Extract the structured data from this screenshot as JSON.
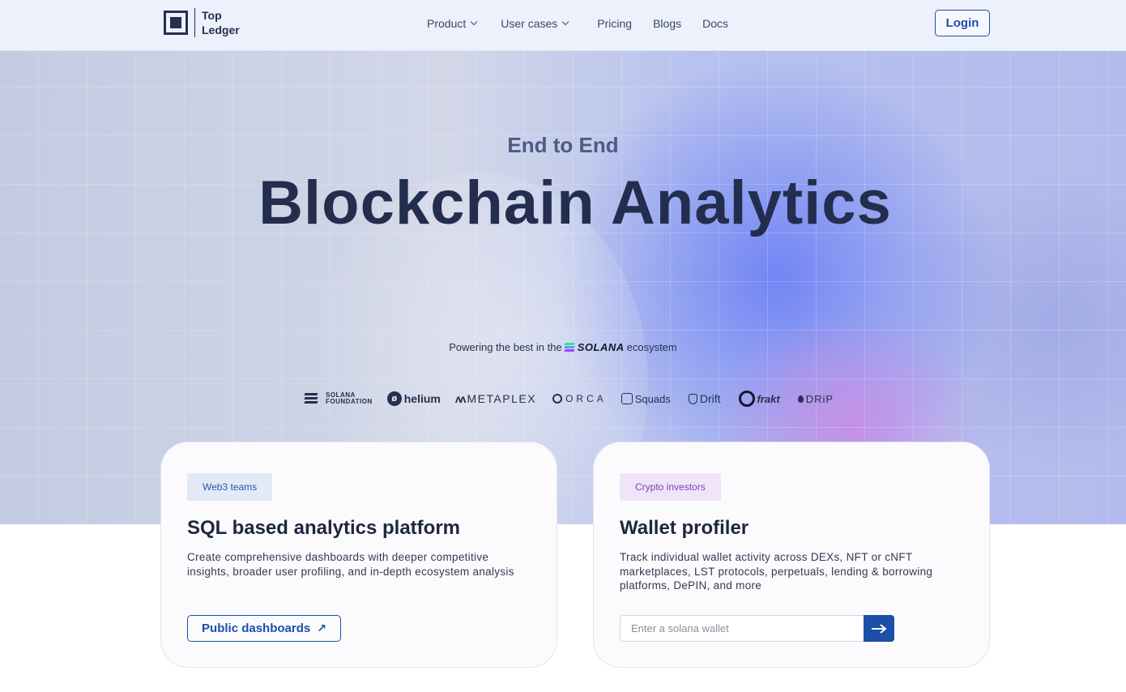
{
  "brand": {
    "line1": "Top",
    "line2": "Ledger"
  },
  "nav": {
    "items": [
      {
        "label": "Product",
        "has_dropdown": true
      },
      {
        "label": "User cases",
        "has_dropdown": true
      },
      {
        "label": "Pricing",
        "has_dropdown": false
      },
      {
        "label": "Blogs",
        "has_dropdown": false
      },
      {
        "label": "Docs",
        "has_dropdown": false
      }
    ],
    "login_label": "Login"
  },
  "hero": {
    "eyebrow": "End to End",
    "headline": "Blockchain Analytics",
    "powering_prefix": "Powering the best in the",
    "powering_brand": "SOLANA",
    "powering_suffix": "ecosystem"
  },
  "partners": {
    "solana_foundation_line1": "SOLANA",
    "solana_foundation_line2": "FOUNDATION",
    "helium": "helium",
    "metaplex": "METAPLEX",
    "orca": "ORCA",
    "squads": "Squads",
    "drift": "Drift",
    "frakt": "frakt",
    "drip": "DRiP"
  },
  "cards": [
    {
      "tag": "Web3 teams",
      "title": "SQL based analytics platform",
      "description": "Create comprehensive dashboards with deeper competitive insights, broader user profiling, and in-depth ecosystem analysis",
      "button_label": "Public dashboards",
      "button_icon": "arrow-up-right-icon"
    },
    {
      "tag": "Crypto investors",
      "title": "Wallet profiler",
      "description": "Track individual wallet activity across DEXs, NFT or cNFT marketplaces, LST protocols, perpetuals, lending & borrowing platforms, DePIN, and more",
      "input_placeholder": "Enter a solana wallet",
      "input_value": "",
      "submit_icon": "arrow-right-icon"
    }
  ],
  "colors": {
    "accent": "#1d4fa8",
    "heading": "#232e4e",
    "tag_blue_bg": "#e3e9f6",
    "tag_purple_bg": "#efe4f8",
    "nav_bg": "#edf1fb"
  }
}
